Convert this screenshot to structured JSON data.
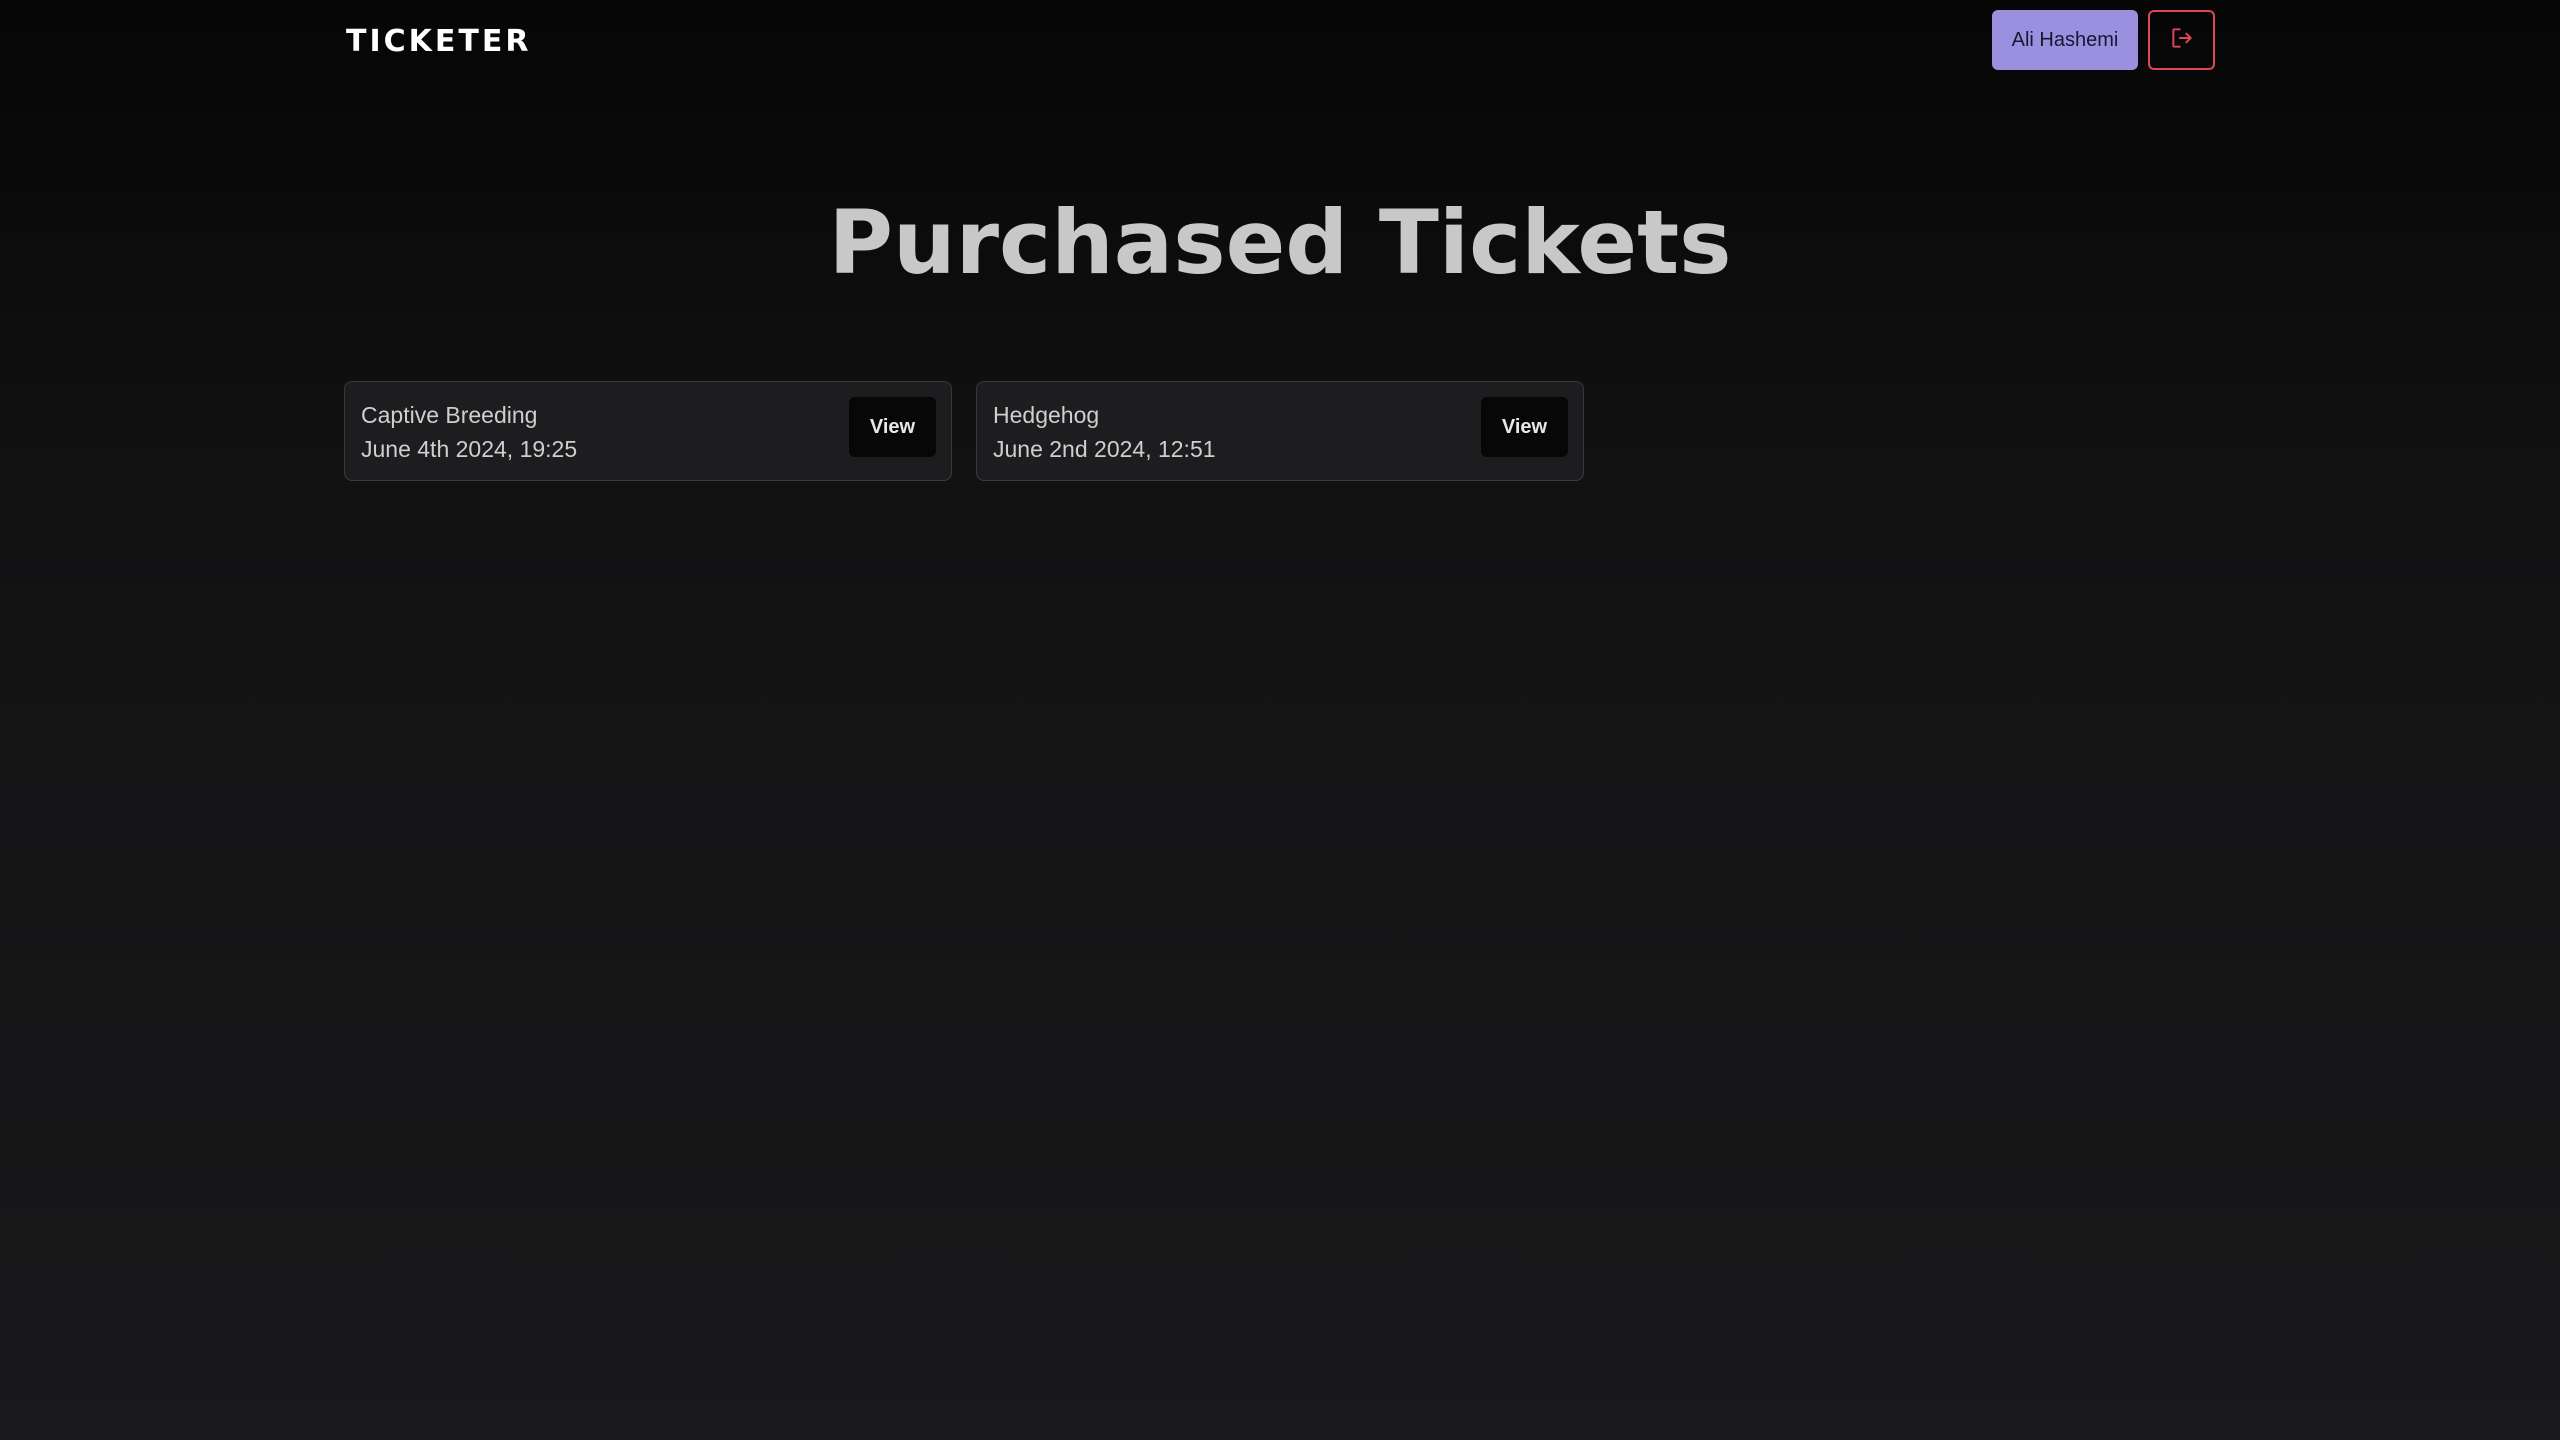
{
  "header": {
    "logo": "TICKETER",
    "user_name": "Ali Hashemi",
    "logout_icon": "logout-icon",
    "logout_color": "#e0455a",
    "user_button_color": "#9b8fe0"
  },
  "main": {
    "title": "Purchased Tickets",
    "tickets": [
      {
        "name": "Captive Breeding",
        "date": "June 4th 2024, 19:25",
        "view_label": "View"
      },
      {
        "name": "Hedgehog",
        "date": "June 2nd 2024, 12:51",
        "view_label": "View"
      }
    ]
  }
}
